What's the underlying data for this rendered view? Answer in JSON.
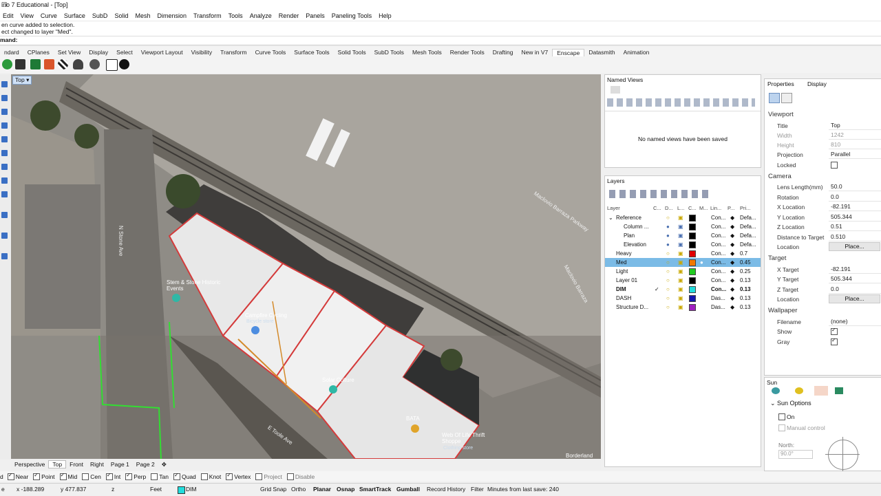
{
  "window": {
    "title": "ino 7 Educational - [Top]"
  },
  "menu": [
    "Edit",
    "View",
    "Curve",
    "Surface",
    "SubD",
    "Solid",
    "Mesh",
    "Dimension",
    "Transform",
    "Tools",
    "Analyze",
    "Render",
    "Panels",
    "Paneling Tools",
    "Help"
  ],
  "history": [
    "en curve added to selection.",
    "ect changed to layer \"Med\"."
  ],
  "command": {
    "prompt": "mand:"
  },
  "toolbar_tabs": [
    "ndard",
    "CPlanes",
    "Set View",
    "Display",
    "Select",
    "Viewport Layout",
    "Visibility",
    "Transform",
    "Curve Tools",
    "Surface Tools",
    "Solid Tools",
    "SubD Tools",
    "Mesh Tools",
    "Render Tools",
    "Drafting",
    "New in V7",
    "Enscape",
    "Datasmith",
    "Animation"
  ],
  "active_tab": "Enscape",
  "viewport": {
    "label": "Top",
    "streets": [
      "N Stone Ave",
      "E Toole Ave",
      "Maclovio Barraza Parkway",
      "Maclovio Barraza"
    ],
    "places": [
      "Stem & Stone Historic Events",
      "Campfire Cycling",
      "Bicycle store",
      "Solar Culture",
      "BATA",
      "Web Of Life Thrift Shoppe",
      "Clothing store",
      "Borderland"
    ]
  },
  "viewport_tabs": [
    "Perspective",
    "Top",
    "Front",
    "Right",
    "Page 1",
    "Page 2"
  ],
  "viewport_tab_active": "Top",
  "named_views": {
    "title": "Named Views",
    "empty_text": "No named views have been saved"
  },
  "layers": {
    "title": "Layers",
    "headers": [
      "Layer",
      "C...",
      "D...",
      "L...",
      "C...",
      "M...",
      "Lin...",
      "P...",
      "Pri..."
    ],
    "rows": [
      {
        "name": "Reference",
        "linetype": "Con...",
        "pstyle": "Defa...",
        "color": "#000000"
      },
      {
        "name": "Column ...",
        "linetype": "Con...",
        "pstyle": "Defa...",
        "color": "#000000"
      },
      {
        "name": "Plan",
        "linetype": "Con...",
        "pstyle": "Defa...",
        "color": "#000000"
      },
      {
        "name": "Elevation",
        "linetype": "Con...",
        "pstyle": "Defa...",
        "color": "#000000"
      },
      {
        "name": "Heavy",
        "linetype": "Con...",
        "pstyle": "0.7",
        "color": "#e00000"
      },
      {
        "name": "Med",
        "linetype": "Con...",
        "pstyle": "0.45",
        "color": "#f07800"
      },
      {
        "name": "Light",
        "linetype": "Con...",
        "pstyle": "0.25",
        "color": "#22cc22"
      },
      {
        "name": "Layer 01",
        "linetype": "Con...",
        "pstyle": "0.13",
        "color": "#000000"
      },
      {
        "name": "DIM",
        "linetype": "Con...",
        "pstyle": "0.13",
        "color": "#22dddd",
        "current": "✓"
      },
      {
        "name": "DASH",
        "linetype": "Das...",
        "pstyle": "0.13",
        "color": "#1515b0"
      },
      {
        "name": "Structure D...",
        "linetype": "Das...",
        "pstyle": "0.13",
        "color": "#a020c0"
      }
    ]
  },
  "properties": {
    "tab_properties": "Properties",
    "tab_display": "Display",
    "viewport_section": "Viewport",
    "title_label": "Title",
    "title_value": "Top",
    "width_label": "Width",
    "width_value": "1242",
    "height_label": "Height",
    "height_value": "810",
    "projection_label": "Projection",
    "projection_value": "Parallel",
    "locked_label": "Locked",
    "camera_section": "Camera",
    "lens_label": "Lens Length(mm)",
    "lens_value": "50.0",
    "rotation_label": "Rotation",
    "rotation_value": "0.0",
    "xloc_label": "X Location",
    "xloc_value": "-82.191",
    "yloc_label": "Y Location",
    "yloc_value": "505.344",
    "zloc_label": "Z Location",
    "zloc_value": "0.51",
    "dist_label": "Distance to Target",
    "dist_value": "0.510",
    "location_label": "Location",
    "place_btn": "Place...",
    "target_section": "Target",
    "xt_label": "X Target",
    "xt_value": "-82.191",
    "yt_label": "Y Target",
    "yt_value": "505.344",
    "zt_label": "Z Target",
    "zt_value": "0.0",
    "tlocation_label": "Location",
    "tplace_btn": "Place...",
    "wallpaper_section": "Wallpaper",
    "filename_label": "Filename",
    "filename_value": "(none)",
    "show_label": "Show",
    "gray_label": "Gray"
  },
  "sun": {
    "title": "Sun",
    "options": "Sun Options",
    "on": "On",
    "manual": "Manual control",
    "north": "North:",
    "north_value": "90.0°"
  },
  "osnaps": [
    {
      "label": "Near",
      "on": true
    },
    {
      "label": "Point",
      "on": true
    },
    {
      "label": "Mid",
      "on": true
    },
    {
      "label": "Cen",
      "on": false
    },
    {
      "label": "Int",
      "on": true
    },
    {
      "label": "Perp",
      "on": true
    },
    {
      "label": "Tan",
      "on": false
    },
    {
      "label": "Quad",
      "on": true
    },
    {
      "label": "Knot",
      "on": false
    },
    {
      "label": "Vertex",
      "on": true
    },
    {
      "label": "Project",
      "on": false
    },
    {
      "label": "Disable",
      "on": false
    }
  ],
  "status": {
    "cplane": "e",
    "x": "x -188.289",
    "y": "y 477.837",
    "z": "z",
    "units": "Feet",
    "layer": "DIM",
    "grid": "Grid Snap",
    "ortho": "Ortho",
    "planar": "Planar",
    "osnap": "Osnap",
    "smarttrack": "SmartTrack",
    "gumball": "Gumball",
    "record": "Record History",
    "filter": "Filter",
    "save": "Minutes from last save: 240"
  }
}
